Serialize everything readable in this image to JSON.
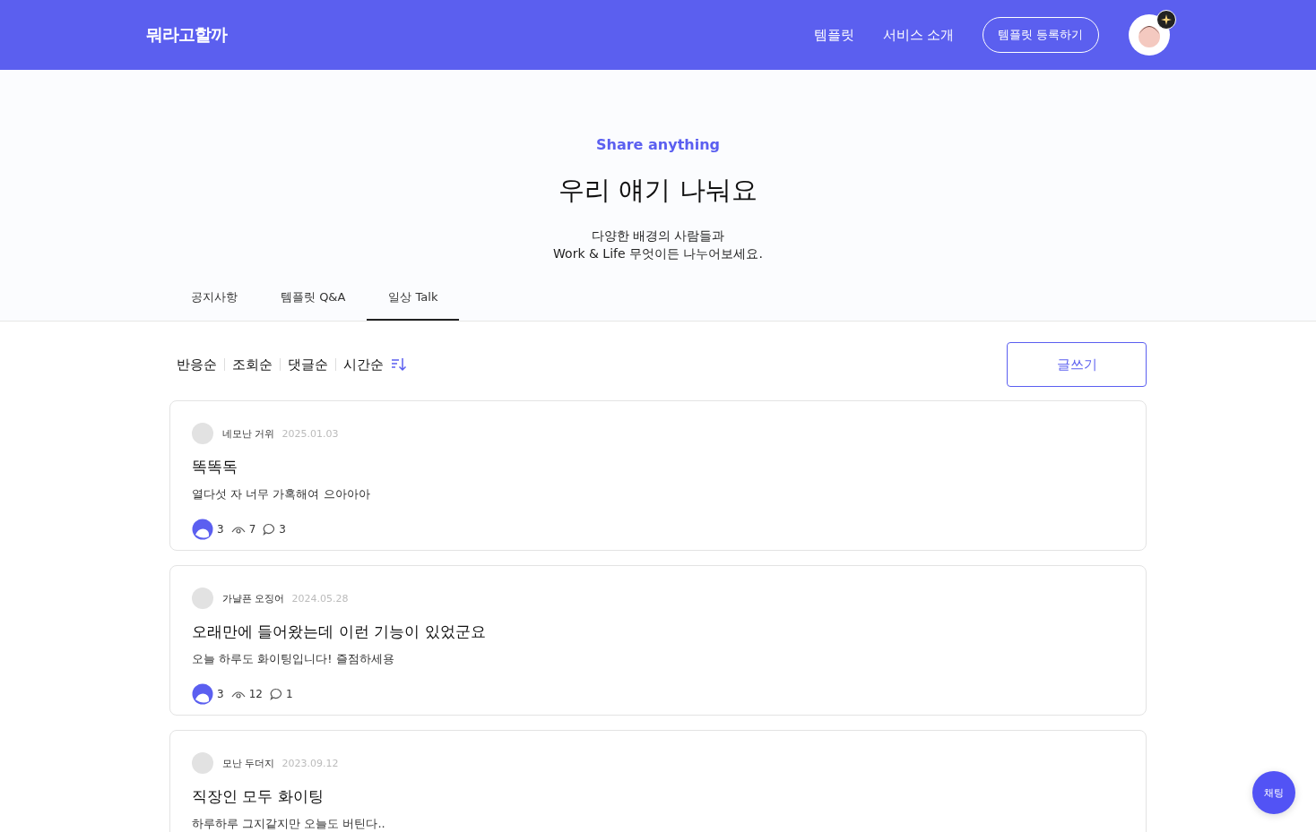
{
  "header": {
    "logo": "뭐라고할까",
    "nav": [
      "템플릿",
      "서비스 소개"
    ],
    "register_button": "템플릿 등록하기"
  },
  "hero": {
    "eyebrow": "Share anything",
    "title": "우리 얘기 나눠요",
    "description": [
      "다양한 배경의 사람들과",
      "Work & Life 무엇이든 나누어보세요."
    ]
  },
  "tabs": [
    {
      "label": "공지사항",
      "selected": false
    },
    {
      "label": "템플릿 Q&A",
      "selected": false
    },
    {
      "label": "일상 Talk",
      "selected": true
    }
  ],
  "sort_options": [
    "반응순",
    "조회순",
    "댓글순",
    "시간순"
  ],
  "write_button": "글쓰기",
  "posts": [
    {
      "author": "네모난 거위",
      "date": "2025.01.03",
      "title": "똑똑독",
      "body": "열다섯 자 너무 가혹해여 으아아아",
      "stats": {
        "reactions": "3",
        "views": "7",
        "comments": "3"
      }
    },
    {
      "author": "가냘픈 오징어",
      "date": "2024.05.28",
      "title": "오래만에 들어왔는데 이런 기능이 있었군요",
      "body": "오늘 하루도 화이팅입니다! 즐점하세용",
      "stats": {
        "reactions": "3",
        "views": "12",
        "comments": "1"
      }
    },
    {
      "author": "모난 두더지",
      "date": "2023.09.12",
      "title": "직장인 모두 화이팅",
      "body": "하루하루 그지같지만 오늘도 버틴다.."
    }
  ],
  "chat_button": "채팅"
}
